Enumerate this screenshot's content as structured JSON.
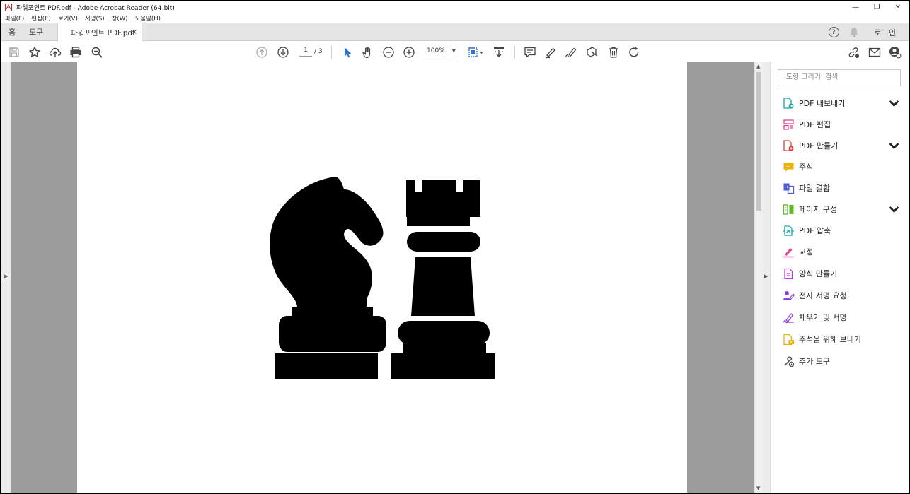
{
  "window": {
    "title": "파워포인트 PDF.pdf - Adobe Acrobat Reader (64-bit)",
    "minimize": "—",
    "restore": "❐",
    "close": "✕"
  },
  "menu": [
    "파일(F)",
    "편집(E)",
    "보기(V)",
    "서명(S)",
    "창(W)",
    "도움말(H)"
  ],
  "tabs": {
    "home": "홈",
    "tools": "도구",
    "document": "파워포인트 PDF.pdf",
    "close": "×"
  },
  "header_right": {
    "help": "?",
    "login": "로그인"
  },
  "toolbar": {
    "page_current": "1",
    "page_total": "/ 3",
    "zoom": "100%"
  },
  "right_pane": {
    "search_placeholder": "'도형 그리기' 검색",
    "tools": [
      {
        "label": "PDF 내보내기",
        "icon": "export-pdf-icon",
        "color": "#1aa3a3",
        "expandable": true
      },
      {
        "label": "PDF 편집",
        "icon": "edit-pdf-icon",
        "color": "#e84393",
        "expandable": false
      },
      {
        "label": "PDF 만들기",
        "icon": "create-pdf-icon",
        "color": "#e0393e",
        "expandable": true
      },
      {
        "label": "주석",
        "icon": "comment-icon",
        "color": "#e8b300",
        "expandable": false
      },
      {
        "label": "파일 결합",
        "icon": "combine-files-icon",
        "color": "#4b5bd6",
        "expandable": false
      },
      {
        "label": "페이지 구성",
        "icon": "organize-pages-icon",
        "color": "#5fb82a",
        "expandable": true
      },
      {
        "label": "PDF 압축",
        "icon": "compress-pdf-icon",
        "color": "#1aa3a3",
        "expandable": false
      },
      {
        "label": "교정",
        "icon": "redact-icon",
        "color": "#e84393",
        "expandable": false
      },
      {
        "label": "양식 만들기",
        "icon": "prepare-form-icon",
        "color": "#b93fd8",
        "expandable": false
      },
      {
        "label": "전자 서명 요청",
        "icon": "request-signature-icon",
        "color": "#8f3fd8",
        "expandable": false
      },
      {
        "label": "채우기 및 서명",
        "icon": "fill-sign-icon",
        "color": "#8f3fd8",
        "expandable": false
      },
      {
        "label": "주석을 위해 보내기",
        "icon": "send-for-comments-icon",
        "color": "#e8b300",
        "expandable": false
      },
      {
        "label": "추가 도구",
        "icon": "more-tools-icon",
        "color": "#555555",
        "expandable": false
      }
    ],
    "chevron": "⌄"
  },
  "colors": {
    "select_tool": "#2d6fd8",
    "page_bg": "#ffffff",
    "gutter": "#9c9c9c"
  }
}
